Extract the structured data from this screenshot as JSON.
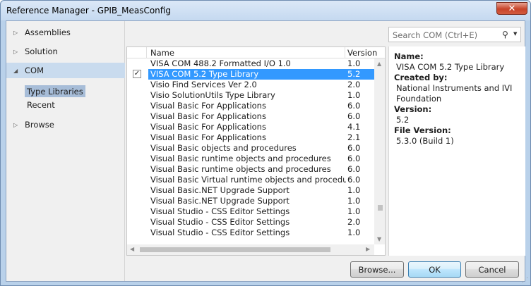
{
  "window": {
    "title": "Reference Manager - GPIB_MeasConfig",
    "close_label": "✕"
  },
  "nav": {
    "items": [
      {
        "label": "Assemblies"
      },
      {
        "label": "Solution"
      },
      {
        "label": "COM"
      },
      {
        "label": "Browse"
      }
    ],
    "com_subitems": [
      {
        "label": "Type Libraries"
      },
      {
        "label": "Recent"
      }
    ]
  },
  "search": {
    "placeholder": "Search COM (Ctrl+E)"
  },
  "list": {
    "columns": {
      "name": "Name",
      "version": "Version"
    },
    "rows": [
      {
        "name": "VISA COM 488.2 Formatted I/O 1.0",
        "version": "1.0",
        "checked": false
      },
      {
        "name": "VISA COM 5.2 Type Library",
        "version": "5.2",
        "checked": true
      },
      {
        "name": "Visio Find Services Ver 2.0",
        "version": "2.0",
        "checked": false
      },
      {
        "name": "Visio SolutionUtils Type Library",
        "version": "1.0",
        "checked": false
      },
      {
        "name": "Visual Basic For Applications",
        "version": "6.0",
        "checked": false
      },
      {
        "name": "Visual Basic For Applications",
        "version": "6.0",
        "checked": false
      },
      {
        "name": "Visual Basic For Applications",
        "version": "4.1",
        "checked": false
      },
      {
        "name": "Visual Basic For Applications",
        "version": "2.1",
        "checked": false
      },
      {
        "name": "Visual Basic objects and procedures",
        "version": "6.0",
        "checked": false
      },
      {
        "name": "Visual Basic runtime objects and procedures",
        "version": "6.0",
        "checked": false
      },
      {
        "name": "Visual Basic runtime objects and procedures",
        "version": "6.0",
        "checked": false
      },
      {
        "name": "Visual Basic Virtual runtime objects and procedur...",
        "version": "6.0",
        "checked": false
      },
      {
        "name": "Visual Basic.NET Upgrade Support",
        "version": "1.0",
        "checked": false
      },
      {
        "name": "Visual Basic.NET Upgrade Support",
        "version": "1.0",
        "checked": false
      },
      {
        "name": "Visual Studio - CSS Editor Settings",
        "version": "1.0",
        "checked": false
      },
      {
        "name": "Visual Studio - CSS Editor Settings",
        "version": "2.0",
        "checked": false
      },
      {
        "name": "Visual Studio - CSS Editor Settings",
        "version": "1.0",
        "checked": false
      }
    ]
  },
  "details": {
    "name_label": "Name:",
    "name_value": "VISA COM 5.2 Type Library",
    "created_label": "Created by:",
    "created_value": "National Instruments and IVI Foundation",
    "version_label": "Version:",
    "version_value": "5.2",
    "file_version_label": "File Version:",
    "file_version_value": "5.3.0 (Build 1)"
  },
  "buttons": {
    "browse": "Browse...",
    "ok": "OK",
    "cancel": "Cancel"
  },
  "colors": {
    "selection": "#3399ff",
    "nav_selected": "#c9dbee"
  }
}
